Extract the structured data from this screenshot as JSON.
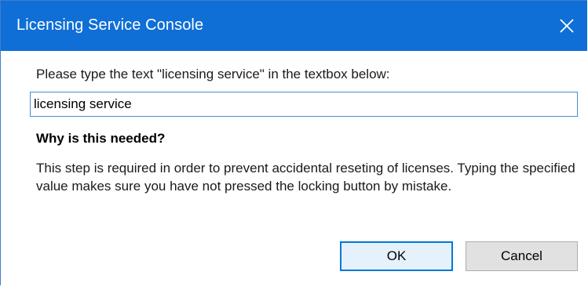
{
  "window": {
    "title": "Licensing Service Console",
    "close_icon": "close-icon",
    "titlebar_color": "#0f6fd6"
  },
  "dialog": {
    "prompt": "Please type the text \"licensing service\" in the textbox below:",
    "input_value": "licensing service",
    "why_heading": "Why is this needed?",
    "why_body": "This step is required in order to prevent accidental reseting of licenses. Typing the specified value makes sure you have not pressed the locking button by mistake."
  },
  "buttons": {
    "ok_label": "OK",
    "cancel_label": "Cancel"
  }
}
